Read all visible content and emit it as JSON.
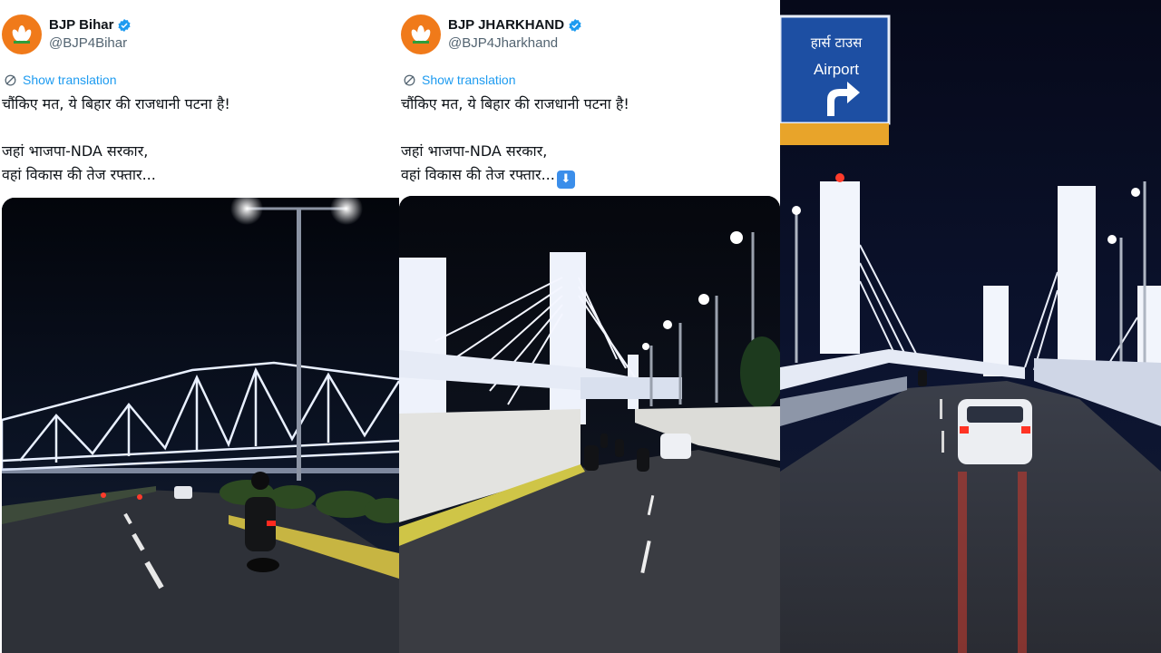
{
  "tweet_bihar": {
    "display_name": "BJP Bihar",
    "handle": "@BJP4Bihar",
    "show_translation": "Show translation",
    "line1": "चौंकिए मत, ये बिहार की राजधानी पटना है!",
    "line2": "जहां भाजपा-NDA सरकार,",
    "line3": "वहां विकास की तेज रफ्तार..."
  },
  "tweet_jharkhand": {
    "display_name": "BJP JHARKHAND",
    "handle": "@BJP4Jharkhand",
    "show_translation": "Show translation",
    "line1": "चौंकिए मत, ये बिहार की राजधानी पटना है!",
    "line2": "जहां भाजपा-NDA सरकार,",
    "line3": "वहां विकास की तेज रफ्तार...",
    "emoji": "⬇"
  },
  "road_sign": {
    "hindi": "हार्स टाउस",
    "english": "Airport"
  },
  "colors": {
    "verified_blue": "#1d9bf0",
    "avatar_orange": "#f07a1a",
    "link_blue": "#1d9bf0",
    "sign_blue": "#1d4fa3"
  },
  "icons": [
    "verified-badge-icon",
    "translate-icon",
    "bjp-lotus-icon",
    "down-arrow-emoji-icon"
  ]
}
